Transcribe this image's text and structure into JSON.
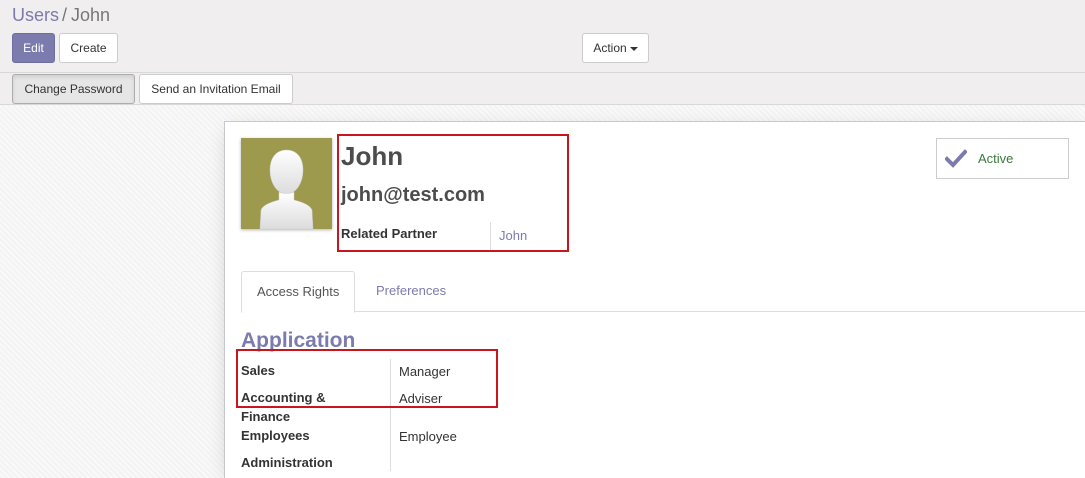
{
  "breadcrumb": {
    "parent": "Users",
    "separator": "/",
    "current": "John"
  },
  "toolbar": {
    "edit_label": "Edit",
    "create_label": "Create",
    "action_label": "Action"
  },
  "statusbar": {
    "change_password_label": "Change Password",
    "invite_label": "Send an Invitation Email"
  },
  "user": {
    "name": "John",
    "email": "john@test.com",
    "related_partner_label": "Related Partner",
    "related_partner_value": "John"
  },
  "active_button": {
    "label": "Active",
    "icon": "check-icon"
  },
  "tabs": [
    {
      "label": "Access Rights",
      "active": true
    },
    {
      "label": "Preferences",
      "active": false
    }
  ],
  "application": {
    "title": "Application",
    "fields": [
      {
        "label": "Sales",
        "value": "Manager"
      },
      {
        "label": "Accounting & Finance",
        "value": "Adviser"
      },
      {
        "label": "Employees",
        "value": "Employee"
      },
      {
        "label": "Administration",
        "value": ""
      }
    ]
  },
  "colors": {
    "brand": "#7c7bad",
    "highlight": "#c9151e",
    "active_text": "#3b7a3b",
    "avatar_bg": "#9d9a4e"
  }
}
